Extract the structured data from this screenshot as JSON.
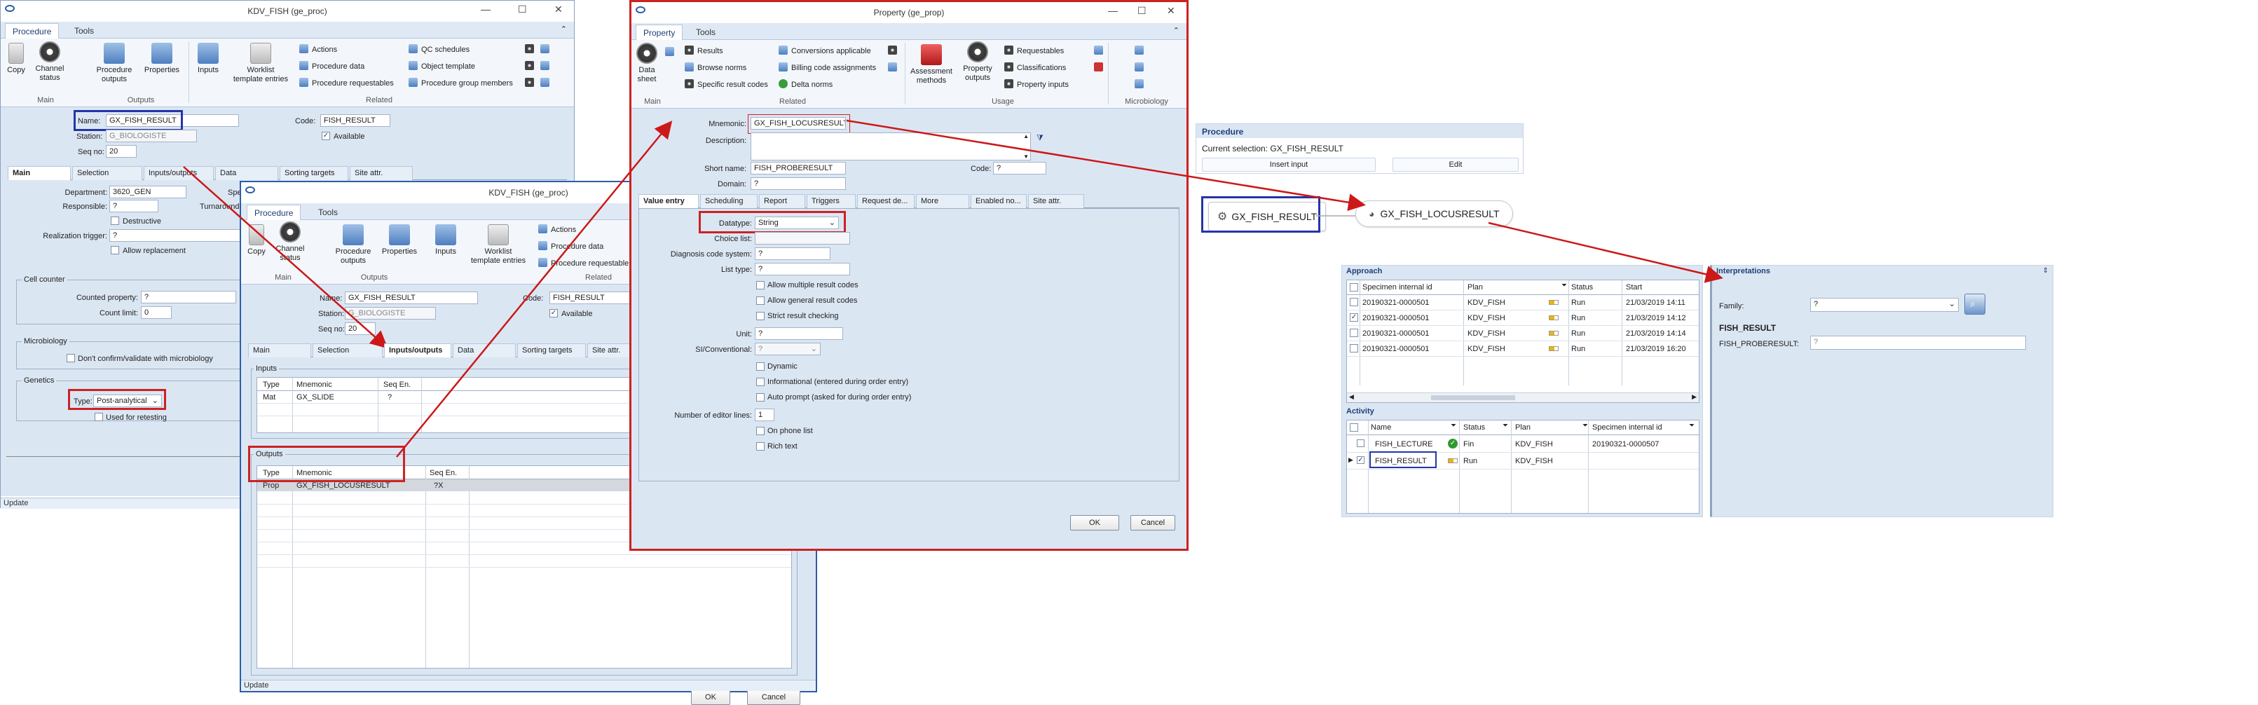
{
  "w1": {
    "title": "KDV_FISH (ge_proc)",
    "tabs": [
      "Procedure",
      "Tools"
    ],
    "ribbon": {
      "copy": "Copy",
      "channel": "Channel\nstatus",
      "outputs": "Procedure\noutputs",
      "properties": "Properties",
      "inputs": "Inputs",
      "worklist": "Worklist\ntemplate entries",
      "actions": "Actions",
      "pdata": "Procedure data",
      "preq": "Procedure requestables",
      "qc": "QC schedules",
      "objtpl": "Object template",
      "pgm": "Procedure group members",
      "grp_main": "Main",
      "grp_outputs": "Outputs",
      "grp_related": "Related"
    },
    "name_label": "Name:",
    "name_value": "GX_FISH_RESULT",
    "code_label": "Code:",
    "code_value": "FISH_RESULT",
    "station_label": "Station:",
    "station_value": "G_BIOLOGISTE",
    "available": "Available",
    "seq_label": "Seq no:",
    "seq_value": "20",
    "subtabs": [
      "Main",
      "Selection",
      "Inputs/outputs",
      "Data",
      "Sorting targets",
      "Site attr."
    ],
    "department_label": "Department:",
    "department_value": "3620_GEN",
    "responsible_label": "Responsible:",
    "responsible_value": "?",
    "destructive": "Destructive",
    "trigger_label": "Realization trigger:",
    "trigger_value": "?",
    "allow_replacement": "Allow replacement",
    "cell_counter": "Cell counter",
    "counted_label": "Counted property:",
    "counted_value": "?",
    "countlimit_label": "Count limit:",
    "countlimit_value": "0",
    "microbiology": "Microbiology",
    "dontconfirm": "Don't confirm/validate with microbiology",
    "genetics": "Genetics",
    "type_label": "Type:",
    "type_value": "Post-analytical",
    "retesting": "Used for retesting",
    "status": "Update",
    "spe_cut": "Spe",
    "tur_cut": "Turnaround"
  },
  "w2": {
    "title": "KDV_FISH (ge_proc)",
    "tabs": [
      "Procedure",
      "Tools"
    ],
    "ribbon": {
      "copy": "Copy",
      "channel": "Channel\nstatus",
      "outputs": "Procedure\noutputs",
      "properties": "Properties",
      "inputs": "Inputs",
      "worklist": "Worklist\ntemplate entries",
      "actions": "Actions",
      "pdata": "Procedure data",
      "preq": "Procedure requestable",
      "grp_main": "Main",
      "grp_outputs": "Outputs",
      "grp_related": "Related"
    },
    "name_label": "Name:",
    "name_value": "GX_FISH_RESULT",
    "code_label": "Code:",
    "code_value": "FISH_RESULT",
    "station_label": "Station:",
    "station_value": "G_BIOLOGISTE",
    "available": "Available",
    "seq_label": "Seq no:",
    "seq_value": "20",
    "subtabs": [
      "Main",
      "Selection",
      "Inputs/outputs",
      "Data",
      "Sorting targets",
      "Site attr."
    ],
    "inputs_title": "Inputs",
    "inputs_cols": [
      "Type",
      "Mnemonic",
      "Seq En."
    ],
    "inputs_rows": [
      [
        "Mat",
        "GX_SLIDE",
        "?"
      ]
    ],
    "outputs_title": "Outputs",
    "outputs_cols": [
      "Type",
      "Mnemonic",
      "Seq En."
    ],
    "outputs_rows": [
      [
        "Prop",
        "GX_FISH_LOCUSRESULT",
        "?X"
      ]
    ],
    "ok": "OK",
    "cancel": "Cancel",
    "status": "Update"
  },
  "w3": {
    "title": "Property (ge_prop)",
    "tabs": [
      "Property",
      "Tools"
    ],
    "ribbon": {
      "datasheet": "Data\nsheet",
      "results": "Results",
      "browse": "Browse norms",
      "specific": "Specific result codes",
      "conversions": "Conversions applicable",
      "billing": "Billing code assignments",
      "delta": "Delta norms",
      "assessment": "Assessment\nmethods",
      "propout": "Property\noutputs",
      "requestables": "Requestables",
      "classifications": "Classifications",
      "propinputs": "Property inputs",
      "grp_main": "Main",
      "grp_related": "Related",
      "grp_usage": "Usage",
      "grp_micro": "Microbiology"
    },
    "mnemonic_label": "Mnemonic:",
    "mnemonic_value": "GX_FISH_LOCUSRESULT",
    "desc_label": "Description:",
    "short_label": "Short name:",
    "short_value": "FISH_PROBERESULT",
    "code_label": "Code:",
    "code_value": "?",
    "domain_label": "Domain:",
    "domain_value": "?",
    "subtabs": [
      "Value entry",
      "Scheduling",
      "Report",
      "Triggers",
      "Request de...",
      "More",
      "Enabled no...",
      "Site attr."
    ],
    "datatype_label": "Datatype:",
    "datatype_value": "String",
    "choice_label": "Choice list:",
    "diag_label": "Diagnosis code system:",
    "diag_value": "?",
    "listtype_label": "List type:",
    "listtype_value": "?",
    "opts1": [
      "Allow multiple result codes",
      "Allow general result codes",
      "Strict result checking"
    ],
    "unit_label": "Unit:",
    "unit_value": "?",
    "si_label": "SI/Conventional:",
    "si_value": "?",
    "opts2": [
      "Dynamic",
      "Informational (entered during order entry)",
      "Auto prompt (asked for during order entry)"
    ],
    "editor_label": "Number of editor lines:",
    "editor_value": "1",
    "opts3": [
      "On phone list",
      "Rich text"
    ],
    "ok": "OK",
    "cancel": "Cancel"
  },
  "proc_panel": {
    "header": "Procedure",
    "current": "Current selection: GX_FISH_RESULT",
    "insert": "Insert input",
    "edit": "Edit"
  },
  "flow": {
    "node1": "GX_FISH_RESULT",
    "node2": "GX_FISH_LOCUSRESULT"
  },
  "approach": {
    "header": "Approach",
    "cols": [
      "Specimen internal id",
      "Plan",
      "Status",
      "Start"
    ],
    "rows": [
      {
        "id": "20190321-0000501",
        "plan": "KDV_FISH",
        "status": "Run",
        "start": "21/03/2019 14:11",
        "checked": false
      },
      {
        "id": "20190321-0000501",
        "plan": "KDV_FISH",
        "status": "Run",
        "start": "21/03/2019 14:12",
        "checked": true
      },
      {
        "id": "20190321-0000501",
        "plan": "KDV_FISH",
        "status": "Run",
        "start": "21/03/2019 14:14",
        "checked": false
      },
      {
        "id": "20190321-0000501",
        "plan": "KDV_FISH",
        "status": "Run",
        "start": "21/03/2019 16:20",
        "checked": false
      }
    ]
  },
  "activity": {
    "header": "Activity",
    "cols": [
      "Name",
      "Status",
      "Plan",
      "Specimen internal id"
    ],
    "rows": [
      {
        "name": "FISH_LECTURE",
        "status": "Fin",
        "plan": "KDV_FISH",
        "spec": "20190321-0000507",
        "checked": false
      },
      {
        "name": "FISH_RESULT",
        "status": "Run",
        "plan": "KDV_FISH",
        "spec": "",
        "checked": true
      }
    ]
  },
  "interp": {
    "header": "Interpretations",
    "family_label": "Family:",
    "family_value": "?",
    "section": "FISH_RESULT",
    "field_label": "FISH_PROBERESULT:",
    "field_value": "?"
  }
}
